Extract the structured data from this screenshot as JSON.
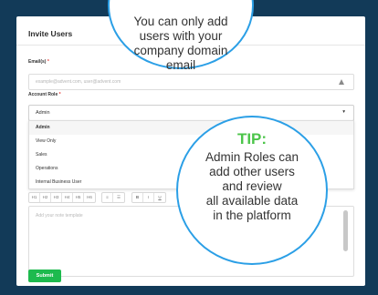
{
  "card": {
    "title": "Invite Users"
  },
  "emails": {
    "label": "Email(s)",
    "required_mark": "*",
    "placeholder": "example@advent.com, user@advent.com"
  },
  "role": {
    "label": "Account Role",
    "required_mark": "*",
    "selected": "Admin",
    "caret": "▾",
    "options": [
      "Admin",
      "View Only",
      "Sales",
      "Operations",
      "Internal Business User"
    ]
  },
  "toolbar": {
    "headings": [
      "H1",
      "H2",
      "H3",
      "H4",
      "H5",
      "H6"
    ],
    "lists": [
      "≡",
      "☰"
    ],
    "formats": [
      "B",
      "I",
      "U"
    ]
  },
  "editor": {
    "placeholder": "Add your note template"
  },
  "submit": {
    "label": "Submit"
  },
  "tooltip_top": {
    "lines": [
      "You can only add",
      "users with your",
      "company domain",
      "email"
    ]
  },
  "tooltip_tip": {
    "heading": "TIP:",
    "lines": [
      "Admin Roles can",
      "add other users",
      "and review",
      "all available data",
      "in the platform"
    ]
  },
  "colors": {
    "background": "#123a58",
    "accent_blue": "#2b9fe6",
    "tip_green": "#4cc54a",
    "submit_green": "#1dba4e",
    "required_red": "#e53935"
  }
}
